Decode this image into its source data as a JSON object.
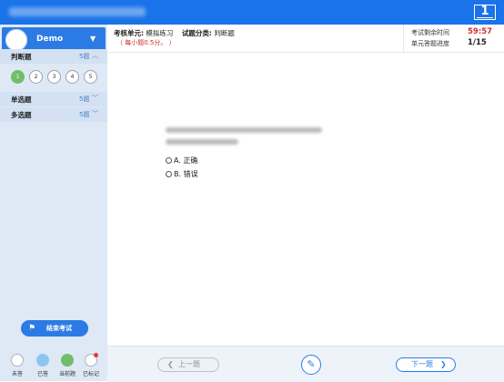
{
  "window": {
    "title": "",
    "corner_button": "1"
  },
  "sidebar": {
    "username": "Demo",
    "user_caret": "▼",
    "sections": [
      {
        "title": "判断题",
        "count": "5题",
        "caret": "︿",
        "expanded": true
      },
      {
        "title": "单选题",
        "count": "5题",
        "caret": "﹀",
        "expanded": false
      },
      {
        "title": "多选题",
        "count": "5题",
        "caret": "﹀",
        "expanded": false
      }
    ],
    "question_numbers": [
      "1",
      "2",
      "3",
      "4",
      "5"
    ],
    "current_question": "1",
    "end_exam_label": "结束考试",
    "legend": [
      {
        "label": "未答",
        "state": "unanswered"
      },
      {
        "label": "已答",
        "state": "answered"
      },
      {
        "label": "当前题",
        "state": "current"
      },
      {
        "label": "已标记",
        "state": "marked"
      }
    ]
  },
  "header": {
    "unit_label": "考核单元:",
    "unit_value": "模拟练习",
    "category_label": "试题分类:",
    "category_value": "判断题",
    "score_note": "（ 每小题0.5分。 ）",
    "time_label": "考试剩余时间",
    "time_value": "59:57",
    "progress_label": "单元答题进度",
    "progress_value": "1/15"
  },
  "question": {
    "stem": "",
    "options": [
      {
        "key": "A.",
        "text": "正确"
      },
      {
        "key": "B.",
        "text": "错误"
      }
    ]
  },
  "footer": {
    "prev_label": "上一题",
    "next_label": "下一题",
    "prev_arrow": "❮",
    "next_arrow": "❯",
    "mark_icon": "✎"
  },
  "colors": {
    "accent": "#1a73e8",
    "current": "#6fbf6a",
    "answered": "#8cc6f0",
    "timer": "#d32f2f"
  }
}
